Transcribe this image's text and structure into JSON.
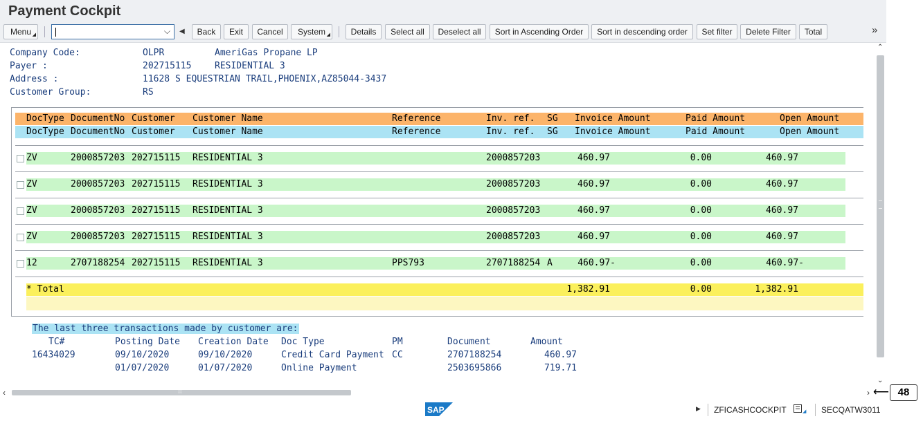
{
  "app": {
    "title": "Payment Cockpit"
  },
  "toolbar": {
    "menu": "Menu",
    "command_value": "",
    "back": "Back",
    "exit": "Exit",
    "cancel": "Cancel",
    "system": "System",
    "details": "Details",
    "select_all": "Select all",
    "deselect_all": "Deselect all",
    "sort_asc": "Sort in Ascending Order",
    "sort_desc": "Sort in descending order",
    "set_filter": "Set filter",
    "delete_filter": "Delete Filter",
    "total": "Total",
    "more": "»"
  },
  "info": {
    "company_code_label": "Company Code:",
    "company_code": "OLPR",
    "company_name": "AmeriGas Propane LP",
    "payer_label": "Payer :",
    "payer": "202715115",
    "payer_name": "RESIDENTIAL 3",
    "address_label": "Address :",
    "address": "11628 S EQUESTRIAN TRAIL,PHOENIX,AZ85044-3437",
    "customer_group_label": "Customer Group:",
    "customer_group": "RS"
  },
  "table": {
    "columns": [
      "DocType",
      "DocumentNo",
      "Customer",
      "Customer Name",
      "Reference",
      "Inv. ref.",
      "SG",
      "Invoice Amount",
      "Paid Amount",
      "Open Amount"
    ],
    "rows": [
      {
        "doctype": "ZV",
        "docno": "2000857203",
        "customer": "202715115",
        "name": "RESIDENTIAL 3",
        "reference": "",
        "invref": "2000857203",
        "sg": "",
        "invoice": "460.97",
        "paid": "0.00",
        "open": "460.97"
      },
      {
        "doctype": "ZV",
        "docno": "2000857203",
        "customer": "202715115",
        "name": "RESIDENTIAL 3",
        "reference": "",
        "invref": "2000857203",
        "sg": "",
        "invoice": "460.97",
        "paid": "0.00",
        "open": "460.97"
      },
      {
        "doctype": "ZV",
        "docno": "2000857203",
        "customer": "202715115",
        "name": "RESIDENTIAL 3",
        "reference": "",
        "invref": "2000857203",
        "sg": "",
        "invoice": "460.97",
        "paid": "0.00",
        "open": "460.97"
      },
      {
        "doctype": "ZV",
        "docno": "2000857203",
        "customer": "202715115",
        "name": "RESIDENTIAL 3",
        "reference": "",
        "invref": "2000857203",
        "sg": "",
        "invoice": "460.97",
        "paid": "0.00",
        "open": "460.97"
      },
      {
        "doctype": "12",
        "docno": "2707188254",
        "customer": "202715115",
        "name": "RESIDENTIAL 3",
        "reference": "PPS793",
        "invref": "2707188254",
        "sg": "A",
        "invoice": "460.97-",
        "paid": "0.00",
        "open": "460.97-"
      }
    ],
    "total": {
      "label": "* Total",
      "invoice": "1,382.91",
      "paid": "0.00",
      "open": "1,382.91"
    }
  },
  "transactions": {
    "heading": "The last three transactions made by customer are:",
    "columns": [
      "TC#",
      "Posting Date",
      "Creation Date",
      "Doc Type",
      "PM",
      "Document",
      "Amount"
    ],
    "rows": [
      {
        "tc": "16434029",
        "posting": "09/10/2020",
        "creation": "09/10/2020",
        "doctype": "Credit Card Payment",
        "pm": "CC",
        "document": "2707188254",
        "amount": "460.97"
      },
      {
        "tc": "",
        "posting": "01/07/2020",
        "creation": "01/07/2020",
        "doctype": "Online Payment",
        "pm": "",
        "document": "2503695866",
        "amount": "719.71"
      }
    ]
  },
  "status": {
    "transaction": "ZFICASHCOCKPIT",
    "system": "SECQATW3011",
    "logo": "SAP"
  },
  "callout": {
    "number": "48"
  },
  "colors": {
    "header_orange": "#fcb46a",
    "header_blue": "#abe3f4",
    "row_green": "#c9f6c9",
    "total_yellow": "#fbf05c",
    "text_blue": "#1a3d7c",
    "sap_blue": "#1b7ac7"
  }
}
